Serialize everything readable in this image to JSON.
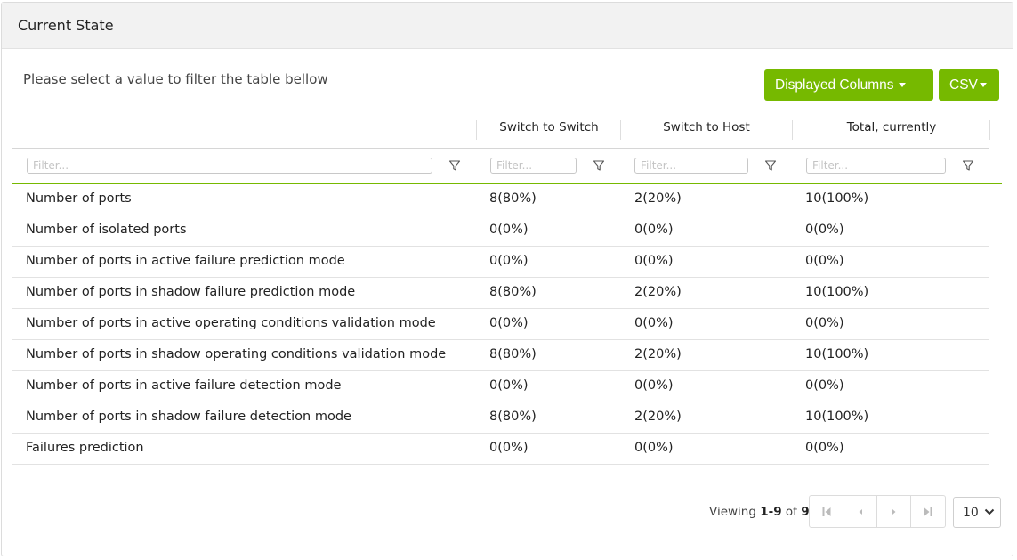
{
  "panel": {
    "title": "Current State"
  },
  "hint": "Please select a value to filter the table bellow",
  "buttons": {
    "displayed_columns": "Displayed Columns",
    "csv": "CSV"
  },
  "columns": [
    "",
    "Switch to Switch",
    "Switch to Host",
    "Total, currently"
  ],
  "filter_placeholder": "Filter...",
  "rows": [
    [
      "Number of ports",
      "8(80%)",
      "2(20%)",
      "10(100%)"
    ],
    [
      "Number of isolated ports",
      "0(0%)",
      "0(0%)",
      "0(0%)"
    ],
    [
      "Number of ports in active failure prediction mode",
      "0(0%)",
      "0(0%)",
      "0(0%)"
    ],
    [
      "Number of ports in shadow failure prediction mode",
      "8(80%)",
      "2(20%)",
      "10(100%)"
    ],
    [
      "Number of ports in active operating conditions validation mode",
      "0(0%)",
      "0(0%)",
      "0(0%)"
    ],
    [
      "Number of ports in shadow operating conditions validation mode",
      "8(80%)",
      "2(20%)",
      "10(100%)"
    ],
    [
      "Number of ports in active failure detection mode",
      "0(0%)",
      "0(0%)",
      "0(0%)"
    ],
    [
      "Number of ports in shadow failure detection mode",
      "8(80%)",
      "2(20%)",
      "10(100%)"
    ],
    [
      "Failures prediction",
      "0(0%)",
      "0(0%)",
      "0(0%)"
    ]
  ],
  "pagination": {
    "viewing_label": "Viewing",
    "range": "1-9",
    "of_label": "of",
    "total": "9",
    "page_size": "10"
  },
  "icons": [
    "filter-icon",
    "first-page-icon",
    "prev-page-icon",
    "next-page-icon",
    "last-page-icon",
    "chevron-down-icon"
  ],
  "colors": {
    "accent": "#76b900",
    "header_bg": "#f2f2f2"
  }
}
